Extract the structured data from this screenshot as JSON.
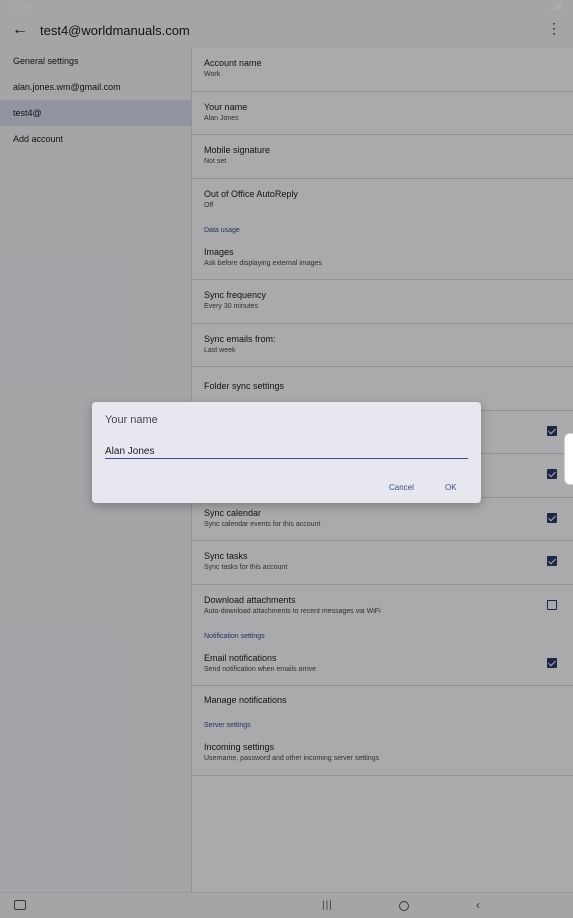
{
  "status_bar": {
    "time": "10:00"
  },
  "app_bar": {
    "back_icon": "arrow-left-icon",
    "title": "test4@worldmanuals.com",
    "overflow_icon": "more-vert-icon"
  },
  "left_pane": {
    "items": [
      {
        "label": "General settings",
        "active": false
      },
      {
        "label": "alan.jones.wm@gmail.com",
        "active": false
      },
      {
        "label": "test4@",
        "active": true
      },
      {
        "label": "Add account",
        "active": false
      }
    ]
  },
  "settings": {
    "account_name": {
      "title": "Account name",
      "value": "Work"
    },
    "your_name": {
      "title": "Your name",
      "value": "Alan Jones"
    },
    "mobile_signature": {
      "title": "Mobile signature",
      "value": "Not set"
    },
    "out_of_office": {
      "title": "Out of Office AutoReply",
      "value": "Off"
    },
    "data_usage_header": "Data usage",
    "images": {
      "title": "Images",
      "value": "Ask before displaying external images"
    },
    "sync_frequency": {
      "title": "Sync frequency",
      "value": "Every 30 minutes"
    },
    "sync_emails_from": {
      "title": "Sync emails from:",
      "value": "Last week"
    },
    "folder_sync": {
      "title": "Folder sync settings"
    },
    "hidden_row_1": {
      "checked": true
    },
    "hidden_row_2": {
      "checked": true
    },
    "sync_calendar": {
      "title": "Sync calendar",
      "value": "Sync calendar events for this account",
      "checked": true
    },
    "sync_tasks": {
      "title": "Sync tasks",
      "value": "Sync tasks for this account",
      "checked": true
    },
    "download_attachments": {
      "title": "Download attachments",
      "value": "Auto-download attachments to recent messages via WiFi",
      "checked": false
    },
    "notification_header": "Notification settings",
    "email_notifications": {
      "title": "Email notifications",
      "value": "Send notification when emails arrive",
      "checked": true
    },
    "manage_notifications": {
      "title": "Manage notifications"
    },
    "server_header": "Server settings",
    "incoming_settings": {
      "title": "Incoming settings",
      "value": "Username, password and other incoming server settings"
    }
  },
  "dialog": {
    "title": "Your name",
    "input_value": "Alan Jones",
    "cancel_label": "Cancel",
    "ok_label": "OK"
  },
  "colors": {
    "accent": "#3a4a8a",
    "dialog_bg": "#e7e7f0",
    "active_item": "#d7dcea"
  }
}
